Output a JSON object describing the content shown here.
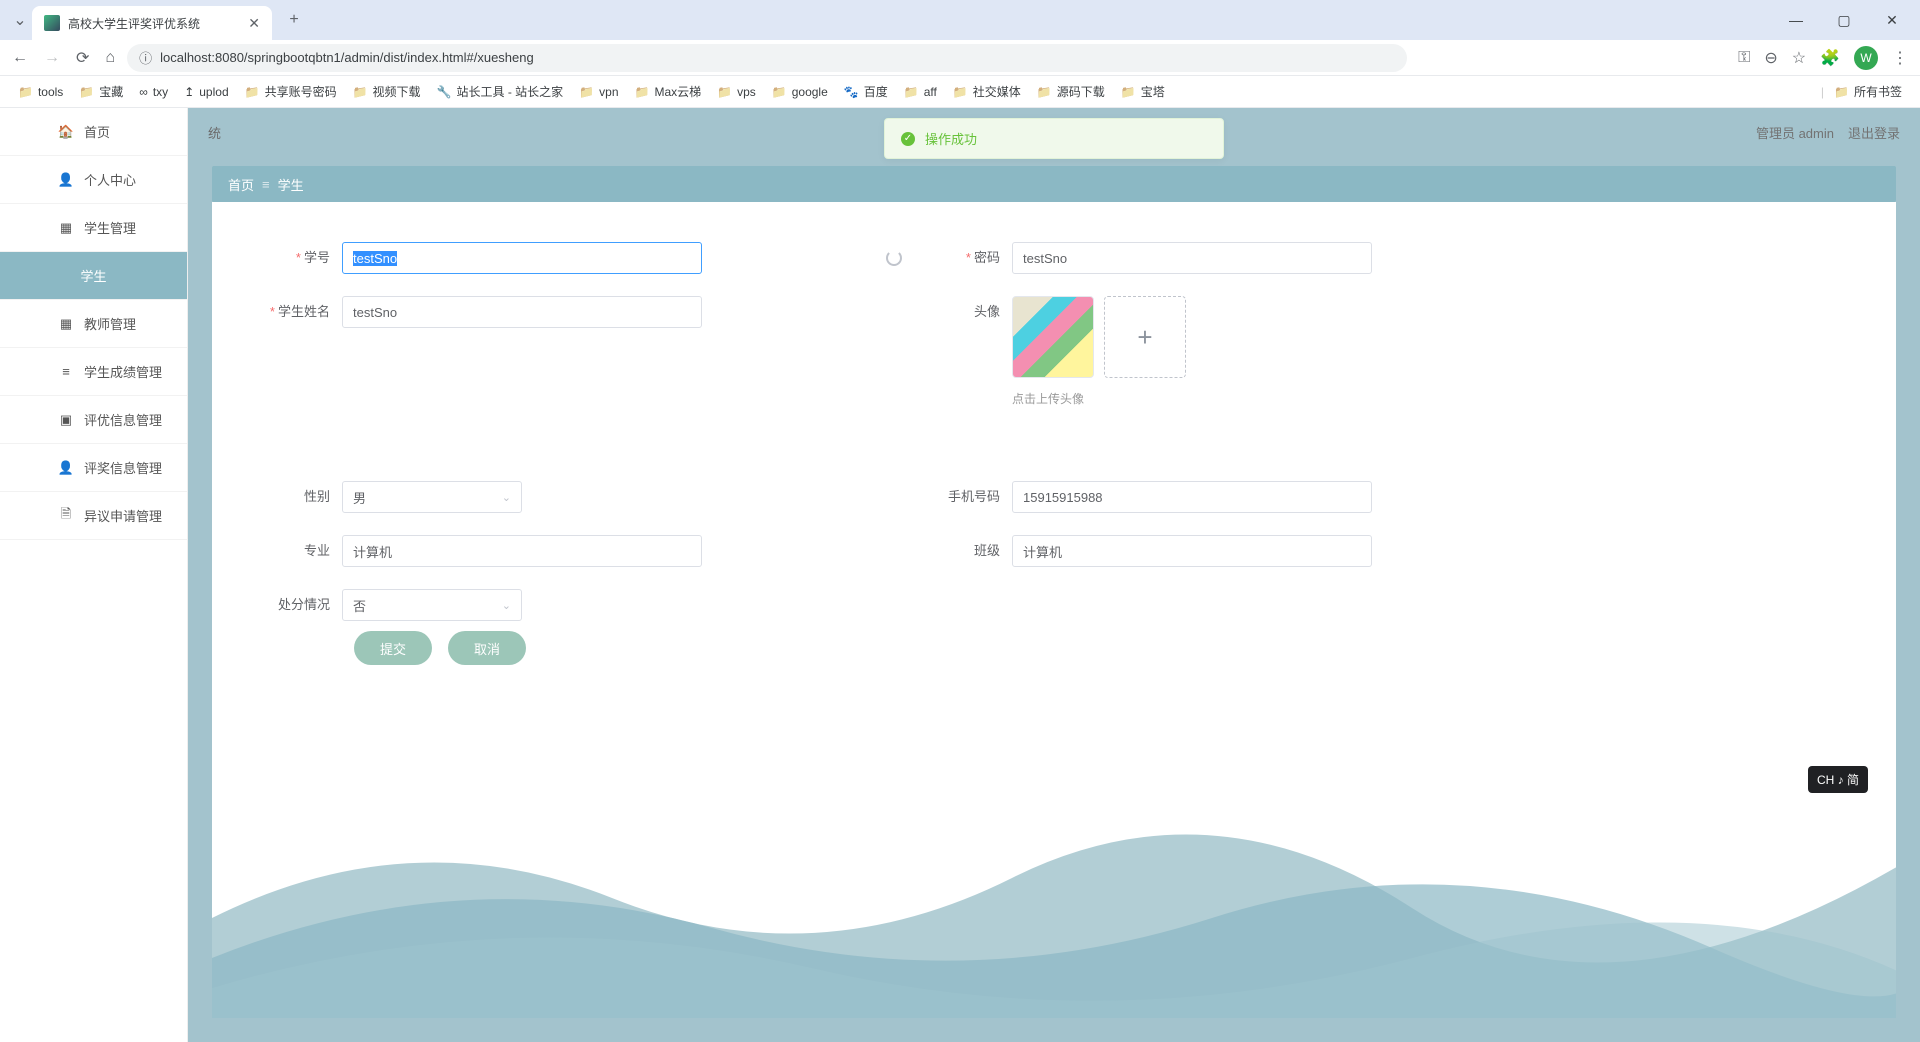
{
  "browser": {
    "tab_title": "高校大学生评奖评优系统",
    "url": "localhost:8080/springbootqbtn1/admin/dist/index.html#/xuesheng",
    "avatar_letter": "W",
    "new_tab": "+",
    "close_tab": "✕",
    "win_min": "—",
    "win_max": "▢",
    "win_close": "✕",
    "all_bookmarks": "所有书签"
  },
  "bookmarks": [
    {
      "label": "tools",
      "folder": true
    },
    {
      "label": "宝藏",
      "folder": true
    },
    {
      "label": "txy",
      "folder": false
    },
    {
      "label": "uplod",
      "folder": false
    },
    {
      "label": "共享账号密码",
      "folder": true
    },
    {
      "label": "视频下载",
      "folder": true
    },
    {
      "label": "站长工具 - 站长之家",
      "folder": false
    },
    {
      "label": "vpn",
      "folder": true
    },
    {
      "label": "Max云梯",
      "folder": true
    },
    {
      "label": "vps",
      "folder": true
    },
    {
      "label": "google",
      "folder": true
    },
    {
      "label": "百度",
      "folder": false
    },
    {
      "label": "aff",
      "folder": true
    },
    {
      "label": "社交媒体",
      "folder": true
    },
    {
      "label": "源码下载",
      "folder": true
    },
    {
      "label": "宝塔",
      "folder": true
    }
  ],
  "sidebar": {
    "items": [
      {
        "icon": "🏠",
        "label": "首页"
      },
      {
        "icon": "👤",
        "label": "个人中心"
      },
      {
        "icon": "▦",
        "label": "学生管理"
      },
      {
        "icon": "",
        "label": "学生",
        "child": true
      },
      {
        "icon": "▦",
        "label": "教师管理"
      },
      {
        "icon": "≡",
        "label": "学生成绩管理"
      },
      {
        "icon": "▣",
        "label": "评优信息管理"
      },
      {
        "icon": "👤",
        "label": "评奖信息管理"
      },
      {
        "icon": "🗎",
        "label": "异议申请管理"
      }
    ]
  },
  "header": {
    "system_suffix": "统",
    "admin_label": "管理员 admin",
    "logout": "退出登录"
  },
  "toast": {
    "text": "操作成功"
  },
  "crumb": {
    "home": "首页",
    "current": "学生"
  },
  "form": {
    "labels": {
      "sno": "学号",
      "name": "学生姓名",
      "pwd": "密码",
      "avatar": "头像",
      "upload_hint": "点击上传头像",
      "gender": "性别",
      "phone": "手机号码",
      "major": "专业",
      "class": "班级",
      "punish": "处分情况"
    },
    "values": {
      "sno": "testSno",
      "name": "testSno",
      "pwd": "testSno",
      "gender": "男",
      "phone": "15915915988",
      "major": "计算机",
      "class": "计算机",
      "punish": "否"
    },
    "buttons": {
      "submit": "提交",
      "cancel": "取消"
    }
  },
  "ime": {
    "text": "CH ♪ 简"
  }
}
